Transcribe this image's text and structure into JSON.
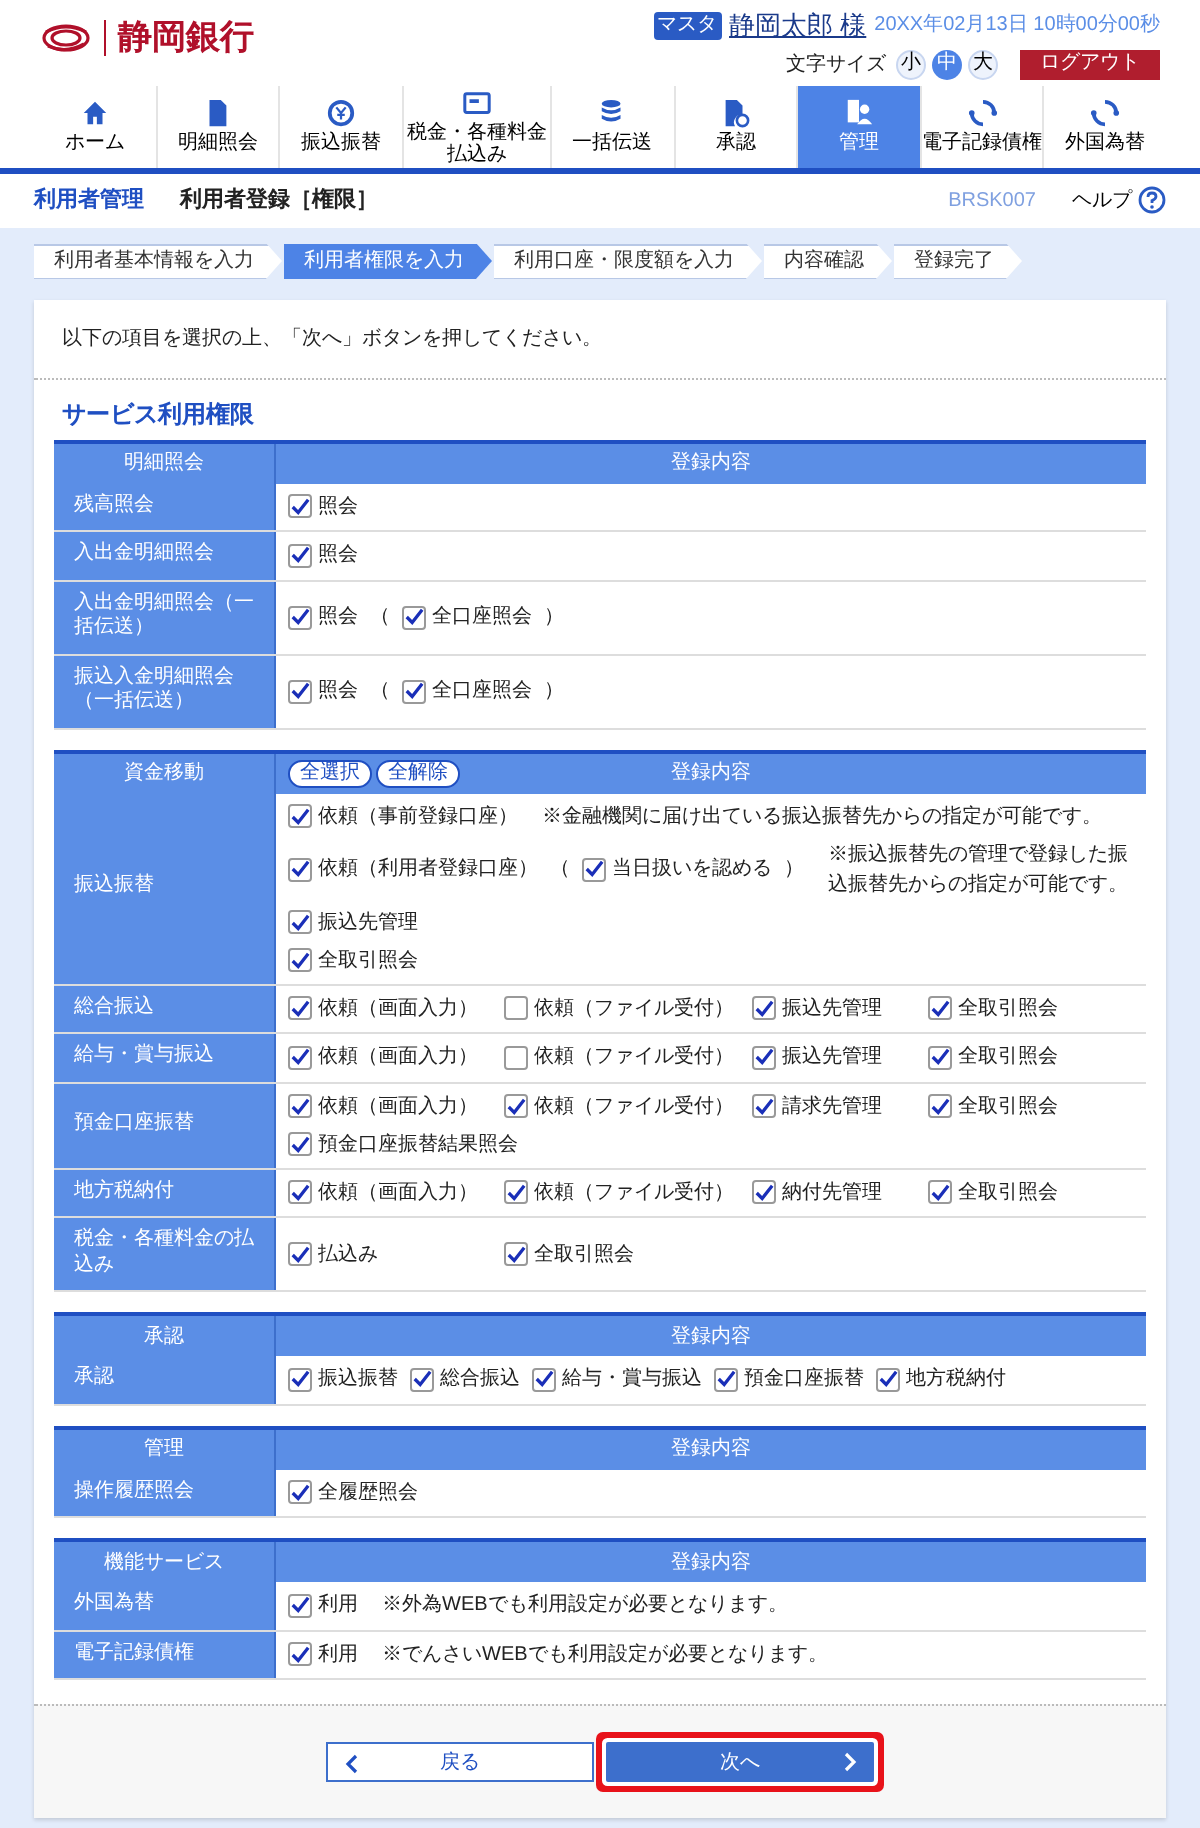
{
  "header": {
    "bank_name": "静岡銀行",
    "user_badge": "マスタ",
    "user_name": "静岡太郎 様",
    "datetime": "20XX年02月13日 10時00分00秒",
    "font_size_label": "文字サイズ",
    "font_sizes": [
      {
        "label": "小",
        "selected": false
      },
      {
        "label": "中",
        "selected": true
      },
      {
        "label": "大",
        "selected": false
      }
    ],
    "logout": "ログアウト"
  },
  "nav": [
    {
      "label": "ホーム",
      "selected": false
    },
    {
      "label": "明細照会",
      "selected": false
    },
    {
      "label": "振込振替",
      "selected": false
    },
    {
      "label": "税金・各種料金払込み",
      "selected": false
    },
    {
      "label": "一括伝送",
      "selected": false
    },
    {
      "label": "承認",
      "selected": false
    },
    {
      "label": "管理",
      "selected": true
    },
    {
      "label": "電子記録債権",
      "selected": false
    },
    {
      "label": "外国為替",
      "selected": false
    }
  ],
  "page": {
    "section": "利用者管理",
    "title": "利用者登録［権限］",
    "screen_id": "BRSK007",
    "help": "ヘルプ"
  },
  "steps": [
    {
      "label": "利用者基本情報を入力",
      "selected": false
    },
    {
      "label": "利用者権限を入力",
      "selected": true
    },
    {
      "label": "利用口座・限度額を入力",
      "selected": false
    },
    {
      "label": "内容確認",
      "selected": false
    },
    {
      "label": "登録完了",
      "selected": false
    }
  ],
  "instruction": "以下の項目を選択の上、「次へ」ボタンを押してください。",
  "section_title": "サービス利用権限",
  "tables": [
    {
      "header_label": "明細照会",
      "header_content": "登録内容",
      "rows": [
        {
          "label": "残高照会",
          "kind": "flow",
          "lines": [
            [
              {
                "kind": "checkbox",
                "label": "照会",
                "checked": true
              }
            ]
          ]
        },
        {
          "label": "入出金明細照会",
          "kind": "flow",
          "lines": [
            [
              {
                "kind": "checkbox",
                "label": "照会",
                "checked": true
              }
            ]
          ]
        },
        {
          "label": "入出金明細照会（一括伝送）",
          "kind": "flow",
          "lines": [
            [
              {
                "kind": "checkbox",
                "label": "照会",
                "checked": true
              },
              {
                "kind": "text",
                "text": "（"
              },
              {
                "kind": "checkbox",
                "label": "全口座照会",
                "checked": true
              },
              {
                "kind": "text",
                "text": "）"
              }
            ]
          ]
        },
        {
          "label": "振込入金明細照会（一括伝送）",
          "kind": "flow",
          "lines": [
            [
              {
                "kind": "checkbox",
                "label": "照会",
                "checked": true
              },
              {
                "kind": "text",
                "text": "（"
              },
              {
                "kind": "checkbox",
                "label": "全口座照会",
                "checked": true
              },
              {
                "kind": "text",
                "text": "）"
              }
            ]
          ]
        }
      ]
    },
    {
      "header_label": "資金移動",
      "header_content": "登録内容",
      "header_buttons": [
        "全選択",
        "全解除"
      ],
      "rows": [
        {
          "label": "振込振替",
          "kind": "flow",
          "lines": [
            [
              {
                "kind": "checkbox",
                "label": "依頼（事前登録口座）",
                "checked": true
              },
              {
                "kind": "note",
                "text": "※金融機関に届け出ている振込振替先からの指定が可能です。"
              }
            ],
            [
              {
                "kind": "checkbox",
                "label": "依頼（利用者登録口座）",
                "checked": true
              },
              {
                "kind": "text",
                "text": "（"
              },
              {
                "kind": "checkbox",
                "label": "当日扱いを認める",
                "checked": true
              },
              {
                "kind": "text",
                "text": "）"
              },
              {
                "kind": "note",
                "text": "※振込振替先の管理で登録した振込振替先からの指定が可能です。"
              }
            ],
            [
              {
                "kind": "checkbox",
                "label": "振込先管理",
                "checked": true
              }
            ],
            [
              {
                "kind": "checkbox",
                "label": "全取引照会",
                "checked": true
              }
            ]
          ]
        },
        {
          "label": "総合振込",
          "kind": "grid",
          "lines": [
            [
              {
                "kind": "checkbox",
                "label": "依頼（画面入力）",
                "checked": true
              },
              {
                "kind": "checkbox",
                "label": "依頼（ファイル受付）",
                "checked": false
              },
              {
                "kind": "checkbox",
                "label": "振込先管理",
                "checked": true
              },
              {
                "kind": "checkbox",
                "label": "全取引照会",
                "checked": true
              }
            ]
          ]
        },
        {
          "label": "給与・賞与振込",
          "kind": "grid",
          "lines": [
            [
              {
                "kind": "checkbox",
                "label": "依頼（画面入力）",
                "checked": true
              },
              {
                "kind": "checkbox",
                "label": "依頼（ファイル受付）",
                "checked": false
              },
              {
                "kind": "checkbox",
                "label": "振込先管理",
                "checked": true
              },
              {
                "kind": "checkbox",
                "label": "全取引照会",
                "checked": true
              }
            ]
          ]
        },
        {
          "label": "預金口座振替",
          "kind": "grid",
          "lines": [
            [
              {
                "kind": "checkbox",
                "label": "依頼（画面入力）",
                "checked": true
              },
              {
                "kind": "checkbox",
                "label": "依頼（ファイル受付）",
                "checked": true
              },
              {
                "kind": "checkbox",
                "label": "請求先管理",
                "checked": true
              },
              {
                "kind": "checkbox",
                "label": "全取引照会",
                "checked": true
              }
            ],
            [
              {
                "kind": "checkbox",
                "label": "預金口座振替結果照会",
                "checked": true
              }
            ]
          ]
        },
        {
          "label": "地方税納付",
          "kind": "grid",
          "lines": [
            [
              {
                "kind": "checkbox",
                "label": "依頼（画面入力）",
                "checked": true
              },
              {
                "kind": "checkbox",
                "label": "依頼（ファイル受付）",
                "checked": true
              },
              {
                "kind": "checkbox",
                "label": "納付先管理",
                "checked": true
              },
              {
                "kind": "checkbox",
                "label": "全取引照会",
                "checked": true
              }
            ]
          ]
        },
        {
          "label": "税金・各種料金の払込み",
          "kind": "grid",
          "lines": [
            [
              {
                "kind": "checkbox",
                "label": "払込み",
                "checked": true
              },
              {
                "kind": "checkbox",
                "label": "全取引照会",
                "checked": true
              }
            ]
          ]
        }
      ]
    },
    {
      "header_label": "承認",
      "header_content": "登録内容",
      "rows": [
        {
          "label": "承認",
          "kind": "flow",
          "lines": [
            [
              {
                "kind": "checkbox",
                "label": "振込振替",
                "checked": true
              },
              {
                "kind": "checkbox",
                "label": "総合振込",
                "checked": true
              },
              {
                "kind": "checkbox",
                "label": "給与・賞与振込",
                "checked": true
              },
              {
                "kind": "checkbox",
                "label": "預金口座振替",
                "checked": true
              },
              {
                "kind": "checkbox",
                "label": "地方税納付",
                "checked": true
              }
            ]
          ]
        }
      ]
    },
    {
      "header_label": "管理",
      "header_content": "登録内容",
      "rows": [
        {
          "label": "操作履歴照会",
          "kind": "flow",
          "lines": [
            [
              {
                "kind": "checkbox",
                "label": "全履歴照会",
                "checked": true
              }
            ]
          ]
        }
      ]
    },
    {
      "header_label": "機能サービス",
      "header_content": "登録内容",
      "rows": [
        {
          "label": "外国為替",
          "kind": "flow",
          "lines": [
            [
              {
                "kind": "checkbox",
                "label": "利用",
                "checked": true
              },
              {
                "kind": "note",
                "text": "※外為WEBでも利用設定が必要となります。"
              }
            ]
          ]
        },
        {
          "label": "電子記録債権",
          "kind": "flow",
          "lines": [
            [
              {
                "kind": "checkbox",
                "label": "利用",
                "checked": true
              },
              {
                "kind": "note",
                "text": "※でんさいWEBでも利用設定が必要となります。"
              }
            ]
          ]
        }
      ]
    }
  ],
  "buttons": {
    "back": "戻る",
    "next": {
      "label": "次へ",
      "highlighted": true
    }
  }
}
